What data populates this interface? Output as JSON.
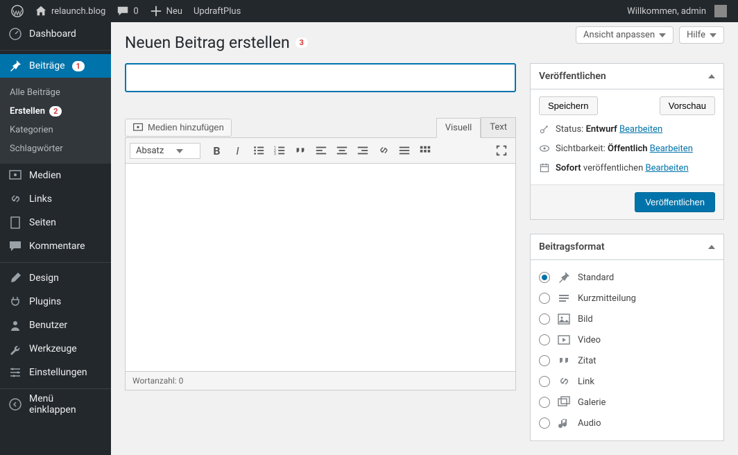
{
  "topbar": {
    "site_name": "relaunch.blog",
    "comments_count": "0",
    "new_label": "Neu",
    "updraftplus": "UpdraftPlus",
    "welcome": "Willkommen, admin"
  },
  "sidebar": {
    "dashboard": "Dashboard",
    "posts": "Beiträge",
    "posts_badge": "1",
    "submenu": {
      "all": "Alle Beiträge",
      "create": "Erstellen",
      "create_badge": "2",
      "categories": "Kategorien",
      "tags": "Schlagwörter"
    },
    "media": "Medien",
    "links": "Links",
    "pages": "Seiten",
    "comments": "Kommentare",
    "design": "Design",
    "plugins": "Plugins",
    "users": "Benutzer",
    "tools": "Werkzeuge",
    "settings": "Einstellungen",
    "collapse": "Menü einklappen"
  },
  "screen_meta": {
    "customize": "Ansicht anpassen",
    "help": "Hilfe"
  },
  "page": {
    "title": "Neuen Beitrag erstellen",
    "title_badge": "3"
  },
  "editor": {
    "add_media": "Medien hinzufügen",
    "tab_visual": "Visuell",
    "tab_text": "Text",
    "format_select": "Absatz",
    "wordcount_label": "Wortanzahl:",
    "wordcount_value": "0"
  },
  "publish": {
    "box_title": "Veröffentlichen",
    "save": "Speichern",
    "preview": "Vorschau",
    "status_label": "Status:",
    "status_value": "Entwurf",
    "status_edit": "Bearbeiten",
    "visibility_label": "Sichtbarkeit:",
    "visibility_value": "Öffentlich",
    "visibility_edit": "Bearbeiten",
    "schedule_bold": "Sofort",
    "schedule_rest": "veröffentlichen",
    "schedule_edit": "Bearbeiten",
    "publish_btn": "Veröffentlichen"
  },
  "format": {
    "box_title": "Beitragsformat",
    "options": [
      "Standard",
      "Kurzmitteilung",
      "Bild",
      "Video",
      "Zitat",
      "Link",
      "Galerie",
      "Audio"
    ]
  }
}
